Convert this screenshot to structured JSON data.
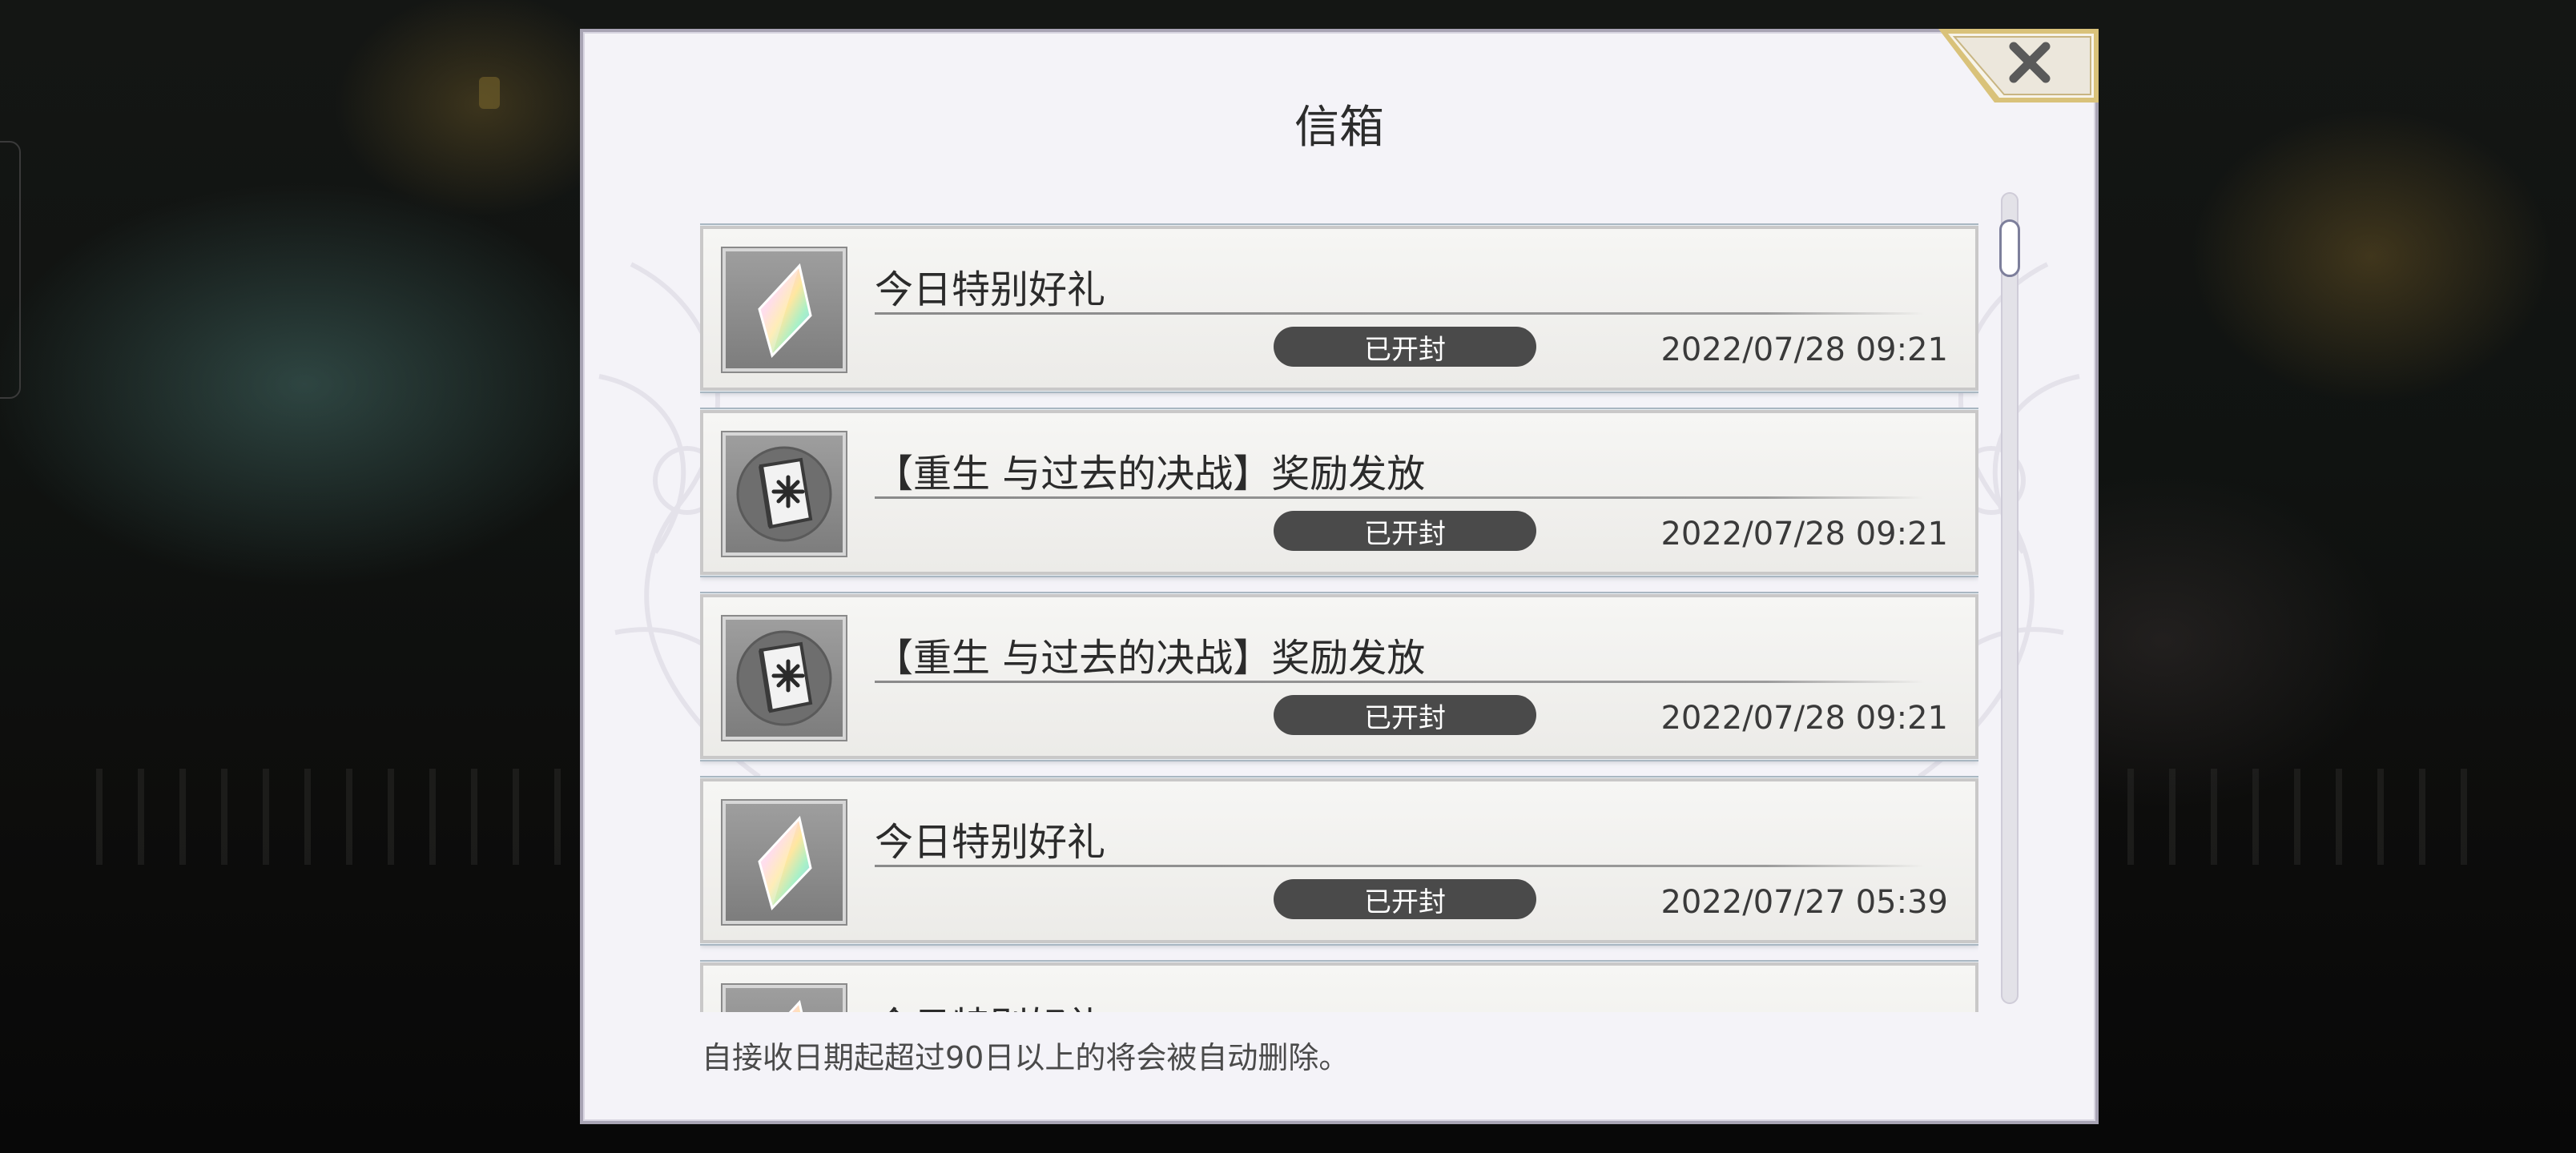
{
  "modal": {
    "title": "信箱",
    "footer_note": "自接收日期起超过90日以上的将会被自动删除。"
  },
  "icons": {
    "close": "close-x-icon",
    "crystal": "rainbow-crystal-icon",
    "book": "star-book-icon"
  },
  "mails": [
    {
      "subject": "今日特别好礼",
      "status": "已开封",
      "date": "2022/07/28 09:21",
      "icon": "rainbow-crystal-icon"
    },
    {
      "subject": "【重生 与过去的决战】奖励发放",
      "status": "已开封",
      "date": "2022/07/28 09:21",
      "icon": "star-book-icon"
    },
    {
      "subject": "【重生 与过去的决战】奖励发放",
      "status": "已开封",
      "date": "2022/07/28 09:21",
      "icon": "star-book-icon"
    },
    {
      "subject": "今日特别好礼",
      "status": "已开封",
      "date": "2022/07/27 05:39",
      "icon": "rainbow-crystal-icon"
    },
    {
      "subject": "今日特别好礼",
      "icon": "rainbow-crystal-icon"
    }
  ],
  "colors": {
    "modal_bg": "#f4f3f8",
    "badge_bg": "#4a4a4a",
    "close_gold": "#d9c27a"
  }
}
